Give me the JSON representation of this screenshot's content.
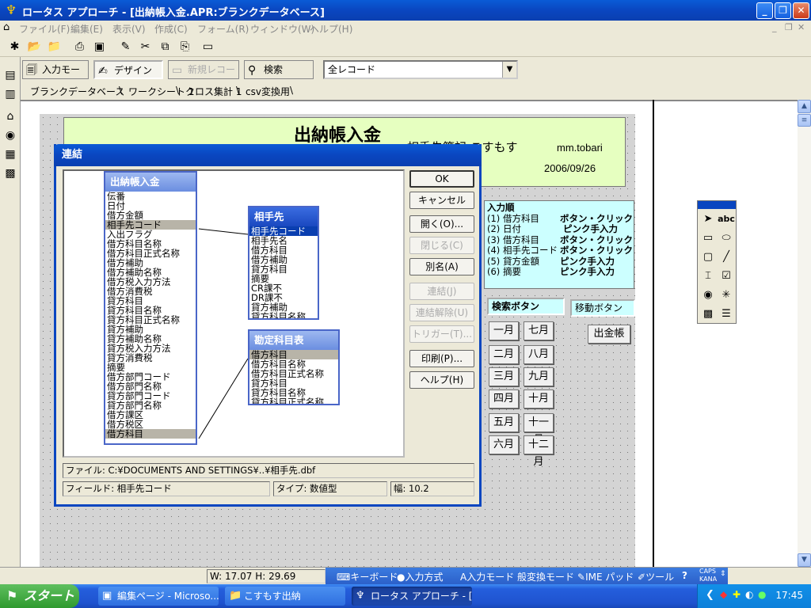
{
  "window": {
    "title": "ロータス アプローチ - [出納帳入金.APR:ブランクデータベース]",
    "controls": [
      "_",
      "❐",
      "✕"
    ]
  },
  "menu": [
    "ファイル(F)",
    "編集(E)",
    "表示(V)",
    "作成(C)",
    "フォーム(R)",
    "ウィンドウ(W)",
    "ヘルプ(H)"
  ],
  "mdi_controls": [
    "_",
    "❐",
    "✕"
  ],
  "modebar": {
    "input_mode": "入力モード",
    "design": "デザイン",
    "new_record": "新規レコード",
    "search": "検索",
    "find_select": "全レコード"
  },
  "tabs": [
    "ブランクデータベース",
    "ワークシート 1",
    "クロス集計 1",
    "csv変換用"
  ],
  "form": {
    "title": "出納帳入金",
    "subtitle": "相手先簿記 こすもす",
    "user": "mm.tobari",
    "date": "2006/09/26",
    "input_order": {
      "heading": "入力順",
      "rows": [
        {
          "left": "(1) 借方科目",
          "right": "ボタン・クリック"
        },
        {
          "left": "(2) 日付",
          "right": "ピンク手入力"
        },
        {
          "left": "(3) 借方科目",
          "right": "ボタン・クリック"
        },
        {
          "left": "(4) 相手先コード",
          "right": "ボタン・クリック"
        },
        {
          "left": "(5) 貸方金額",
          "right": "ピンク手入力"
        },
        {
          "left": "(6) 摘要",
          "right": "ピンク手入力"
        }
      ]
    },
    "search_button_label": "検索ボタン",
    "move_button_label": "移動ボタン",
    "months": [
      "一月",
      "七月",
      "二月",
      "八月",
      "三月",
      "九月",
      "四月",
      "十月",
      "五月",
      "十一月",
      "六月",
      "十二月"
    ],
    "ledger_button": "出金帳"
  },
  "dialog": {
    "title": "連結",
    "buttons": {
      "ok": "OK",
      "cancel": "キャンセル",
      "open": "開く(O)...",
      "close": "閉じる(C)",
      "alias": "別名(A)",
      "join": "連結(J)",
      "unjoin": "連結解除(U)",
      "trigger": "トリガー(T)...",
      "print": "印刷(P)...",
      "help": "ヘルプ(H)"
    },
    "tables": {
      "main": {
        "name": "出納帳入金",
        "fields": [
          "伝番",
          "日付",
          "借方金額",
          "相手先コード",
          "入出フラグ",
          "借方科目名称",
          "借方科目正式名称",
          "借方補助",
          "借方補助名称",
          "借方税入力方法",
          "借方消費税",
          "貸方科目",
          "貸方科目名称",
          "貸方科目正式名称",
          "貸方補助",
          "貸方補助名称",
          "貸方税入力方法",
          "貸方消費税",
          "摘要",
          "借方部門コード",
          "借方部門名称",
          "貸方部門コード",
          "貸方部門名称",
          "借方課区",
          "借方税区",
          "借方科目"
        ]
      },
      "partner": {
        "name": "相手先",
        "fields": [
          "相手先コード",
          "相手先名",
          "借方科目",
          "借方補助",
          "貸方科目",
          "摘要",
          "CR課不",
          "DR課不",
          "貸方補助",
          "貸方科目名称"
        ]
      },
      "account": {
        "name": "勘定科目表",
        "fields": [
          "借方科目",
          "借方科目名称",
          "借方科目正式名称",
          "貸方科目",
          "貸方科目名称",
          "貸方科目正式名称"
        ]
      }
    },
    "file": "ファイル: C:¥DOCUMENTS AND SETTINGS¥..¥相手先.dbf",
    "field": "フィールド: 相手先コード",
    "type": "タイプ: 数値型",
    "width": "幅: 10.2"
  },
  "statusbar": {
    "wh": "W: 17.07  H: 29.69",
    "ime": [
      "キーボード",
      "入力方式",
      "入力モード",
      "変換モード",
      "IME パッド",
      "ツール"
    ],
    "caps": "CAPS",
    "kana": "KANA"
  },
  "taskbar": {
    "start": "スタート",
    "tasks": [
      "編集ページ - Microso...",
      "こすもす出納",
      "ロータス アプローチ - [..."
    ],
    "clock": "17:45"
  },
  "colors": {
    "title_blue": "#0a46c0",
    "form_header_bg": "#e6ffc0",
    "input_order_bg": "#ccffff"
  }
}
